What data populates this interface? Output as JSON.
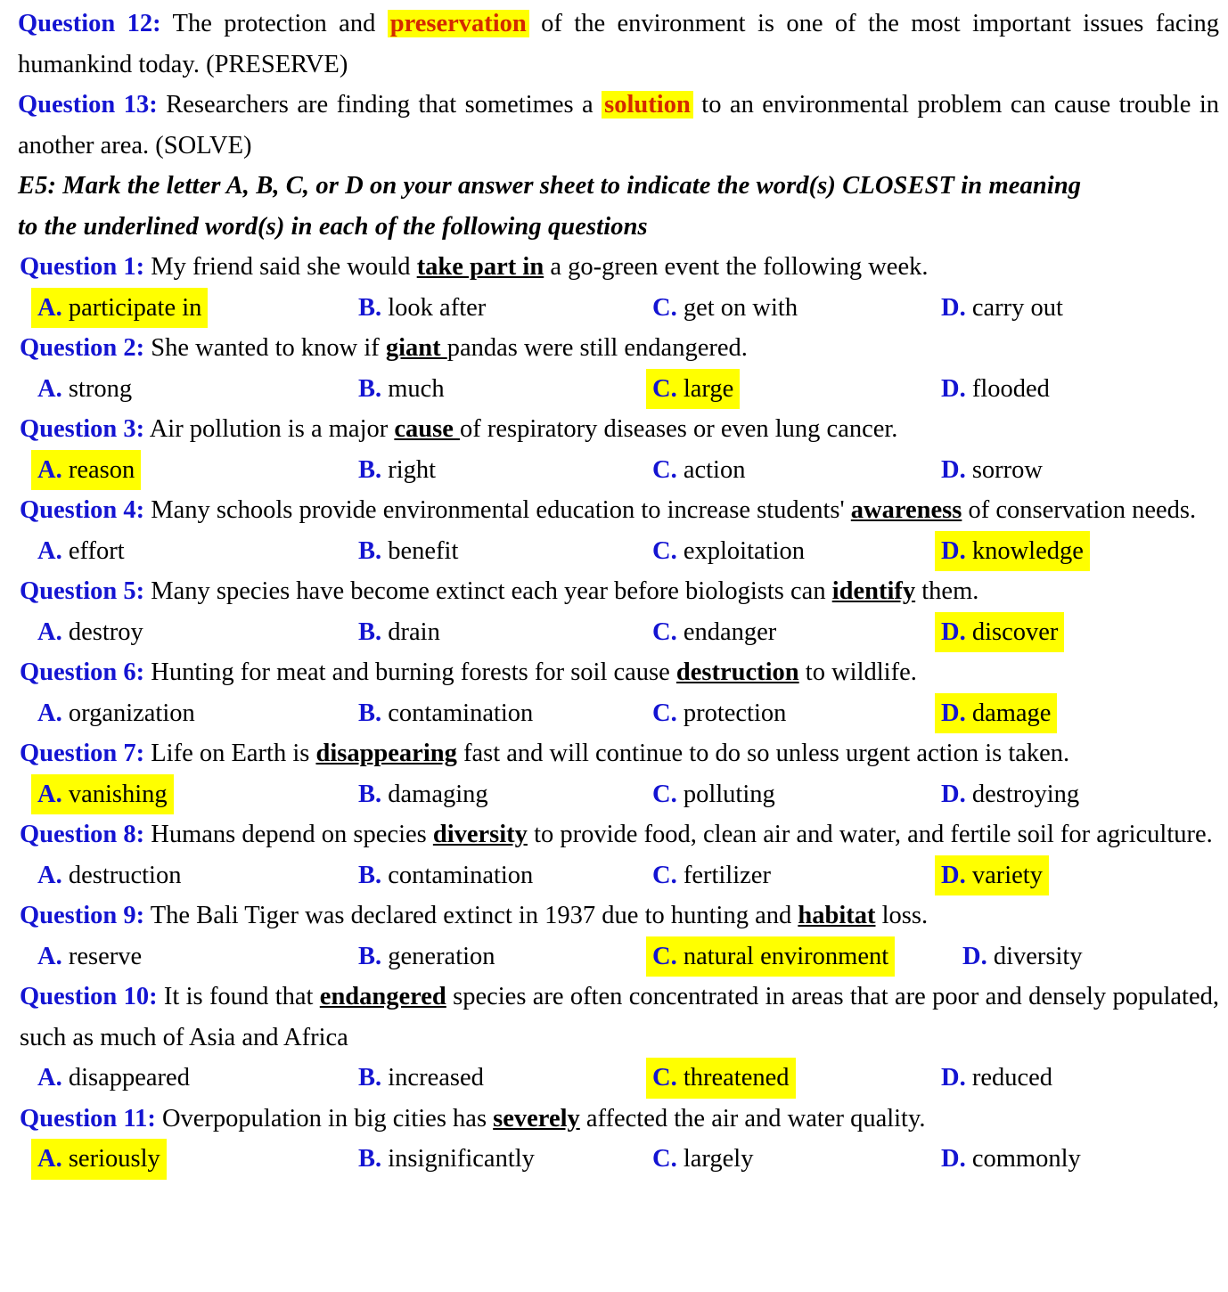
{
  "document": {
    "top_questions": [
      {
        "label": "Question 12:",
        "text_before": " The protection and ",
        "highlight": "preservation",
        "text_after": " of the environment is one of the most important issues facing humankind today. (PRESERVE)"
      },
      {
        "label": "Question 13:",
        "text_before": " Researchers are finding that sometimes a ",
        "highlight": "solution",
        "text_after": " to an environmental problem can cause trouble in another area. (SOLVE)"
      }
    ],
    "section_heading": {
      "line1": "E5: Mark the letter A, B, C, or D on your answer sheet to indicate the word(s) CLOSEST in meaning",
      "line2": "to the underlined word(s) in each of the following questions"
    },
    "questions": [
      {
        "label": "Question 1:",
        "before": " My friend said she would ",
        "underlined": "take part in",
        "after": " a go-green event the following week.",
        "justify": false,
        "options": [
          {
            "letter": "A.",
            "text": " participate in",
            "highlighted": true
          },
          {
            "letter": "B.",
            "text": " look after",
            "highlighted": false
          },
          {
            "letter": "C.",
            "text": " get on with",
            "highlighted": false
          },
          {
            "letter": "D.",
            "text": " carry out",
            "highlighted": false
          }
        ]
      },
      {
        "label": "Question 2:",
        "before": " She wanted to know if ",
        "underlined": "giant ",
        "after": "pandas were still endangered.",
        "justify": false,
        "options": [
          {
            "letter": "A.",
            "text": " strong",
            "highlighted": false
          },
          {
            "letter": "B.",
            "text": " much",
            "highlighted": false
          },
          {
            "letter": "C.",
            "text": " large",
            "highlighted": true
          },
          {
            "letter": "D.",
            "text": " flooded",
            "highlighted": false
          }
        ]
      },
      {
        "label": "Question 3:",
        "before": " Air pollution is a major ",
        "underlined": "cause ",
        "after": "of respiratory diseases or even lung cancer.",
        "justify": false,
        "options": [
          {
            "letter": "A.",
            "text": " reason",
            "highlighted": true
          },
          {
            "letter": "B.",
            "text": " right",
            "highlighted": false
          },
          {
            "letter": "C.",
            "text": " action",
            "highlighted": false
          },
          {
            "letter": "D.",
            "text": " sorrow",
            "highlighted": false
          }
        ]
      },
      {
        "label": "Question 4:",
        "before": " Many schools provide environmental education to increase students' ",
        "underlined": "awareness",
        "after": " of conservation needs.",
        "justify": true,
        "options": [
          {
            "letter": "A.",
            "text": " effort",
            "highlighted": false
          },
          {
            "letter": "B.",
            "text": " benefit",
            "highlighted": false
          },
          {
            "letter": "C.",
            "text": " exploitation",
            "highlighted": false
          },
          {
            "letter": "D.",
            "text": " knowledge",
            "highlighted": true
          }
        ]
      },
      {
        "label": "Question 5:",
        "before": " Many species have become extinct each year before biologists can ",
        "underlined": "identify",
        "after": " them.",
        "justify": false,
        "options": [
          {
            "letter": "A.",
            "text": " destroy",
            "highlighted": false
          },
          {
            "letter": "B.",
            "text": " drain",
            "highlighted": false
          },
          {
            "letter": "C.",
            "text": " endanger",
            "highlighted": false
          },
          {
            "letter": "D.",
            "text": " discover",
            "highlighted": true
          }
        ]
      },
      {
        "label": "Question 6:",
        "before": " Hunting for meat and burning forests for soil cause ",
        "underlined": "destruction",
        "after": " to wildlife.",
        "justify": false,
        "options": [
          {
            "letter": "A.",
            "text": " organization",
            "highlighted": false
          },
          {
            "letter": "B.",
            "text": " contamination",
            "highlighted": false
          },
          {
            "letter": "C.",
            "text": " protection",
            "highlighted": false
          },
          {
            "letter": "D.",
            "text": " damage",
            "highlighted": true
          }
        ]
      },
      {
        "label": "Question 7:",
        "before": " Life on Earth is ",
        "underlined": "disappearing",
        "after": " fast and will continue to do so unless urgent action is taken.",
        "justify": false,
        "options": [
          {
            "letter": "A.",
            "text": " vanishing",
            "highlighted": true
          },
          {
            "letter": "B.",
            "text": " damaging",
            "highlighted": false
          },
          {
            "letter": "C.",
            "text": " polluting",
            "highlighted": false
          },
          {
            "letter": "D.",
            "text": " destroying",
            "highlighted": false
          }
        ]
      },
      {
        "label": "Question 8:",
        "before": " Humans depend on species ",
        "underlined": "diversity",
        "after": " to provide food, clean air and water, and fertile soil for agriculture.",
        "justify": true,
        "options": [
          {
            "letter": "A.",
            "text": " destruction",
            "highlighted": false
          },
          {
            "letter": "B.",
            "text": " contamination",
            "highlighted": false
          },
          {
            "letter": "C.",
            "text": " fertilizer",
            "highlighted": false
          },
          {
            "letter": "D.",
            "text": " variety",
            "highlighted": true
          }
        ]
      },
      {
        "label": "Question 9:",
        "before": " The Bali Tiger was declared extinct in 1937 due to hunting and ",
        "underlined": "habitat",
        "after": " loss.",
        "justify": false,
        "options": [
          {
            "letter": "A.",
            "text": " reserve",
            "highlighted": false
          },
          {
            "letter": "B.",
            "text": " generation",
            "highlighted": false
          },
          {
            "letter": "C.",
            "text": " natural environment",
            "highlighted": true
          },
          {
            "letter": "D.",
            "text": " diversity",
            "highlighted": false
          }
        ]
      },
      {
        "label": "Question 10:",
        "before": " It is found that ",
        "underlined": "endangered",
        "after": " species are often concentrated in areas that are poor and densely populated, such as much of Asia and Africa",
        "justify": true,
        "options": [
          {
            "letter": "A.",
            "text": " disappeared",
            "highlighted": false
          },
          {
            "letter": "B.",
            "text": " increased",
            "highlighted": false
          },
          {
            "letter": "C.",
            "text": " threatened",
            "highlighted": true
          },
          {
            "letter": "D.",
            "text": " reduced",
            "highlighted": false
          }
        ]
      },
      {
        "label": "Question 11:",
        "before": " Overpopulation in big cities has ",
        "underlined": "severely",
        "after": " affected the air and water quality.",
        "justify": false,
        "options": [
          {
            "letter": "A.",
            "text": " seriously",
            "highlighted": true
          },
          {
            "letter": "B.",
            "text": " insignificantly",
            "highlighted": false
          },
          {
            "letter": "C.",
            "text": " largely",
            "highlighted": false
          },
          {
            "letter": "D.",
            "text": " commonly",
            "highlighted": false
          }
        ]
      }
    ],
    "colors": {
      "question_label": "#1414D2",
      "highlight": "#FFFF00",
      "answer_word": "#D42A00",
      "body_text": "#000000"
    }
  }
}
